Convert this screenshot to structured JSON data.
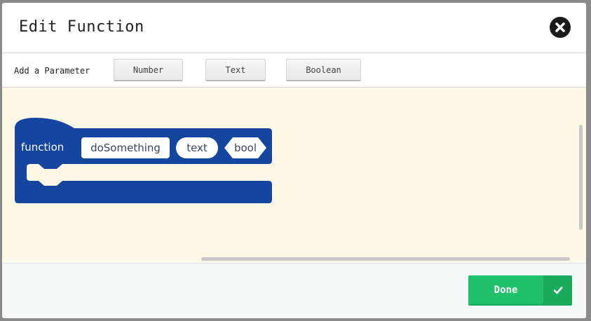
{
  "dialog": {
    "title": "Edit Function",
    "close_icon": "close-circle-icon"
  },
  "params": {
    "label": "Add a Parameter",
    "buttons": [
      "Number",
      "Text",
      "Boolean"
    ]
  },
  "block": {
    "keyword": "function",
    "name": "doSomething",
    "param_text": "text",
    "param_bool": "bool",
    "color": "#1446a0"
  },
  "workspace": {
    "background": "#fef9e6"
  },
  "footer": {
    "done_label": "Done",
    "done_icon": "checkmark-icon",
    "done_color": "#21c16b"
  }
}
